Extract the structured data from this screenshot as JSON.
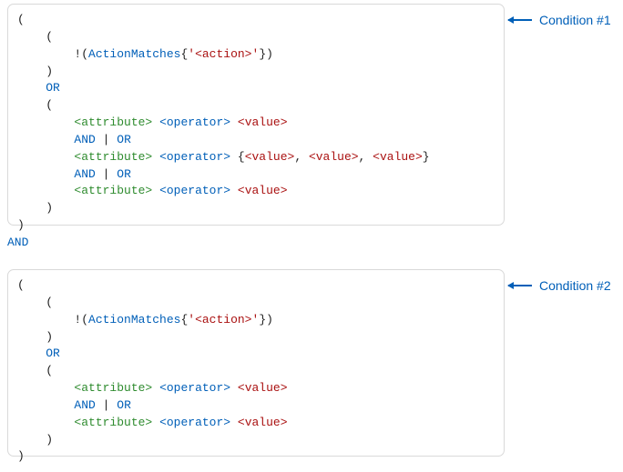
{
  "labels": {
    "cond1": "Condition #1",
    "cond2": "Condition #2"
  },
  "connector": "AND",
  "syntax": {
    "paren_open": "(",
    "paren_close": ")",
    "brace_open": "{",
    "brace_close": "}",
    "comma": ",",
    "space": " ",
    "not_open": "!(",
    "quote": "'"
  },
  "tokens": {
    "actionMatches": "ActionMatches",
    "action_ph": "<action>",
    "attribute_ph": "<attribute>",
    "operator_ph": "<operator>",
    "value_ph": "<value>",
    "or_kw": "OR",
    "and_kw": "AND",
    "pipe": "|"
  }
}
